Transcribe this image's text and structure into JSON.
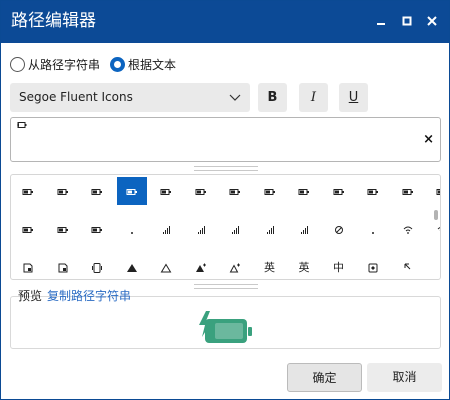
{
  "window": {
    "title": "路径编辑器"
  },
  "title_buttons": {
    "minimize": "minimize-icon",
    "maximize": "maximize-icon",
    "close": "close-icon"
  },
  "mode": {
    "options": [
      {
        "label": "从路径字符串",
        "checked": false
      },
      {
        "label": "根据文本",
        "checked": true
      }
    ]
  },
  "font": {
    "selected": "Segoe Fluent Icons"
  },
  "format": {
    "bold": "B",
    "italic": "I",
    "underline": "U"
  },
  "text_input": {
    "glyph": "battery-charging-icon",
    "clear": "×"
  },
  "glyph_grid": {
    "selected_index": 3,
    "rows": [
      [
        "battery-icon",
        "battery-icon",
        "battery-icon",
        "battery-icon",
        "battery-icon",
        "battery-icon",
        "battery-icon",
        "battery-icon",
        "battery-icon",
        "battery-icon",
        "battery-icon",
        "battery-icon",
        "battery-icon",
        "battery-icon"
      ],
      [
        "battery-icon",
        "battery-icon",
        "battery-icon",
        "dot-icon",
        "signal-bars-icon",
        "signal-bars-icon",
        "signal-bars-icon",
        "signal-bars-icon",
        "signal-bars-icon",
        "blocked-icon",
        "dot-icon",
        "wifi-icon",
        "wifi-icon"
      ],
      [
        "storage-lock-icon",
        "storage-link-icon",
        "phone-icon",
        "triangle-filled-icon",
        "triangle-outline-icon",
        "triangle-plus-icon",
        "triangle-plus-outline-icon",
        "英",
        "英",
        "中",
        "input-icon",
        "cursor-icon"
      ]
    ]
  },
  "preview": {
    "label": "预览",
    "copy": "复制路径字符串",
    "glyph": "battery-charging-icon",
    "color": "#3aa17e"
  },
  "buttons": {
    "ok": "确定",
    "cancel": "取消"
  },
  "colors": {
    "title_bar": "#0c4a96",
    "accent": "#0c64c0",
    "link": "#2b6cc4"
  }
}
